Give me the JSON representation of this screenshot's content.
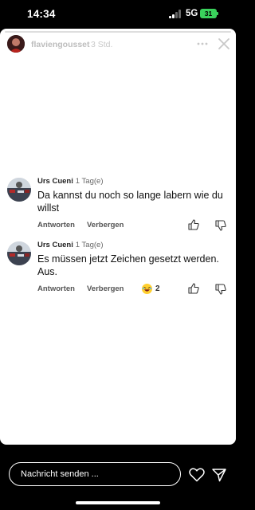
{
  "status_bar": {
    "time": "14:34",
    "network": "5G",
    "battery": "31"
  },
  "story": {
    "username": "flaviengousset",
    "time_ago": "3 Std."
  },
  "comments": [
    {
      "author": "Urs Cueni",
      "time_ago": "· 1 Tag(e)",
      "text": "Da kannst du noch so lange labern wie du willst",
      "reply_label": "Antworten",
      "hide_label": "Verbergen"
    },
    {
      "author": "Urs Cueni",
      "time_ago": "· 1 Tag(e)",
      "text": "Es müssen jetzt Zeichen gesetzt werden. Aus.",
      "reply_label": "Antworten",
      "hide_label": "Verbergen",
      "reaction_count": "2"
    }
  ],
  "message_input": {
    "placeholder": "Nachricht senden ..."
  },
  "colors": {
    "battery": "#3ad25c",
    "background": "#000000",
    "story_bg": "#ffffff"
  }
}
